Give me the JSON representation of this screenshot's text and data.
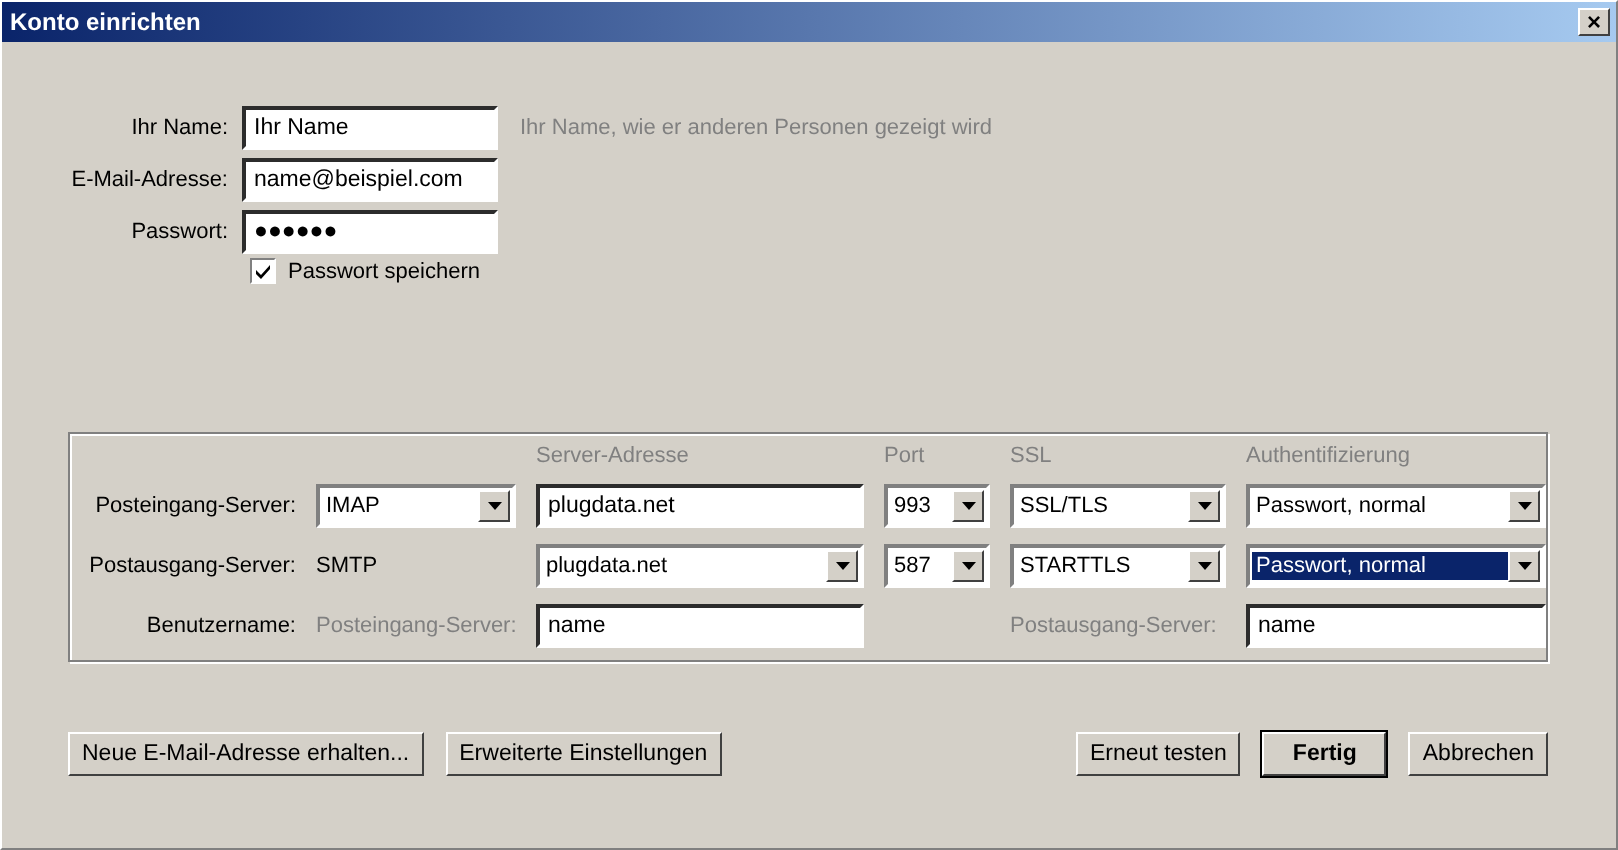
{
  "window": {
    "title": "Konto einrichten",
    "close": "×"
  },
  "identity": {
    "fields": [
      {
        "label": "Ihr Name:",
        "value": "Ihr Name",
        "hint": "Ihr Name, wie er anderen Personen gezeigt wird"
      },
      {
        "label": "E-Mail-Adresse:",
        "value": "name@beispiel.com"
      },
      {
        "label": "Passwort:",
        "value": "●●●●●●"
      }
    ],
    "remember": {
      "label": "Passwort speichern",
      "checked": true
    }
  },
  "servers": {
    "rows": [
      [
        {
          "kind": "blank"
        },
        {
          "kind": "blank"
        },
        {
          "kind": "header",
          "value": "Server-Adresse"
        },
        {
          "kind": "header",
          "value": "Port"
        },
        {
          "kind": "header",
          "value": "SSL"
        },
        {
          "kind": "header",
          "value": "Authentifizierung"
        }
      ],
      [
        {
          "kind": "label",
          "value": "Posteingang-Server:"
        },
        {
          "kind": "combo",
          "value": "IMAP",
          "focused": false
        },
        {
          "kind": "input",
          "value": "plugdata.net"
        },
        {
          "kind": "combo",
          "value": "993",
          "focused": false
        },
        {
          "kind": "combo",
          "value": "SSL/TLS",
          "focused": false
        },
        {
          "kind": "combo",
          "value": "Passwort, normal",
          "focused": false
        }
      ],
      [
        {
          "kind": "label",
          "value": "Postausgang-Server:"
        },
        {
          "kind": "text",
          "value": "SMTP"
        },
        {
          "kind": "combo",
          "value": "plugdata.net",
          "focused": false
        },
        {
          "kind": "combo",
          "value": "587",
          "focused": false
        },
        {
          "kind": "combo",
          "value": "STARTTLS",
          "focused": false
        },
        {
          "kind": "combo",
          "value": "Passwort, normal",
          "focused": true
        }
      ],
      [
        {
          "kind": "label",
          "value": "Benutzername:"
        },
        {
          "kind": "muted",
          "value": "Posteingang-Server:"
        },
        {
          "kind": "input",
          "value": "name"
        },
        {
          "kind": "blank"
        },
        {
          "kind": "muted",
          "value": "Postausgang-Server:"
        },
        {
          "kind": "input",
          "value": "name"
        }
      ]
    ]
  },
  "buttons_left": [
    {
      "label": "Neue E-Mail-Adresse erhalten...",
      "default": false
    },
    {
      "label": "Erweiterte Einstellungen",
      "default": false
    }
  ],
  "buttons_right": [
    {
      "label": "Erneut testen",
      "default": false
    },
    {
      "label": "Fertig",
      "default": true
    },
    {
      "label": "Abbrechen",
      "default": false
    }
  ]
}
